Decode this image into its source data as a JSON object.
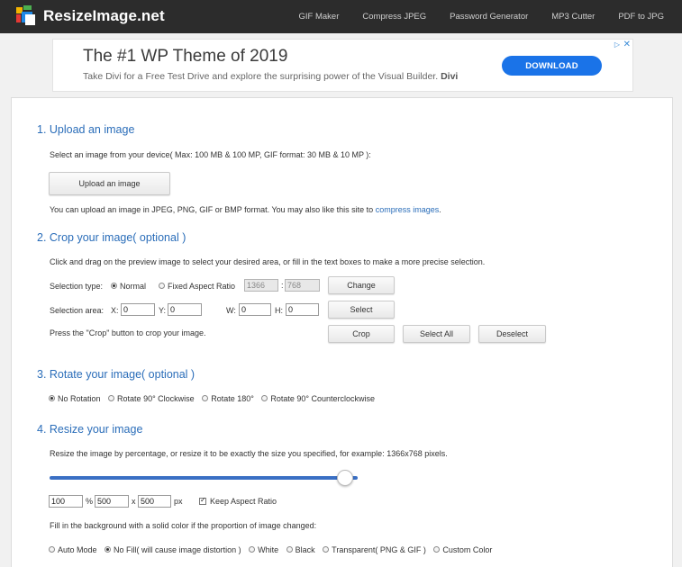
{
  "brand": {
    "name": "ResizeImage.net"
  },
  "nav": [
    "GIF Maker",
    "Compress JPEG",
    "Password Generator",
    "MP3 Cutter",
    "PDF to JPG"
  ],
  "ad": {
    "title": "The #1 WP Theme of 2019",
    "text": "Take Divi for a Free Test Drive and explore the surprising power of the Visual Builder.",
    "text_brand": "Divi",
    "button": "DOWNLOAD",
    "close": "✕",
    "info": "▷"
  },
  "upload": {
    "title": "1. Upload an image",
    "desc": "Select an image from your device( Max: 100 MB & 100 MP, GIF format: 30 MB & 10 MP ):",
    "button": "Upload an image",
    "note": "You can upload an image in JPEG, PNG, GIF or BMP format. You may also like this site to",
    "note_link": "compress images",
    "note_end": "."
  },
  "crop": {
    "title": "2. Crop your image( optional )",
    "desc": "Click and drag on the preview image to select your desired area, or fill in the text boxes to make a more precise selection.",
    "type_label": "Selection type:",
    "type_normal": "Normal",
    "type_fixed": "Fixed Aspect Ratio",
    "ratio_w": "1366",
    "ratio_sep": ":",
    "ratio_h": "768",
    "change": "Change",
    "area_label": "Selection area:",
    "x_label": "X:",
    "x": "0",
    "y_label": "Y:",
    "y": "0",
    "w_label": "W:",
    "w": "0",
    "h_label": "H:",
    "h": "0",
    "select": "Select",
    "hint": "Press the \"Crop\" button to crop your image.",
    "crop_btn": "Crop",
    "select_all": "Select All",
    "deselect": "Deselect"
  },
  "rotate": {
    "title": "3. Rotate your image( optional )",
    "options": [
      "No Rotation",
      "Rotate 90° Clockwise",
      "Rotate 180°",
      "Rotate 90° Counterclockwise"
    ],
    "selected": 0
  },
  "resize": {
    "title": "4. Resize your image",
    "desc": "Resize the image by percentage, or resize it to be exactly the size you specified, for example: 1366x768 pixels.",
    "slider_fraction": 0.96,
    "percent": "100",
    "percent_unit": "%",
    "width": "500",
    "times": "x",
    "height": "500",
    "px_unit": "px",
    "keep_aspect": "Keep Aspect Ratio",
    "fill_desc": "Fill in the background with a solid color if the proportion of image changed:",
    "fill_options": [
      "Auto Mode",
      "No Fill( will cause image distortion )",
      "White",
      "Black",
      "Transparent( PNG & GIF )",
      "Custom Color"
    ],
    "fill_selected": 1
  },
  "colors": {
    "accent": "#2a6db9",
    "topbar": "#2c2c2c",
    "ad_button": "#1a73e8",
    "slider": "#3a6fc4"
  }
}
